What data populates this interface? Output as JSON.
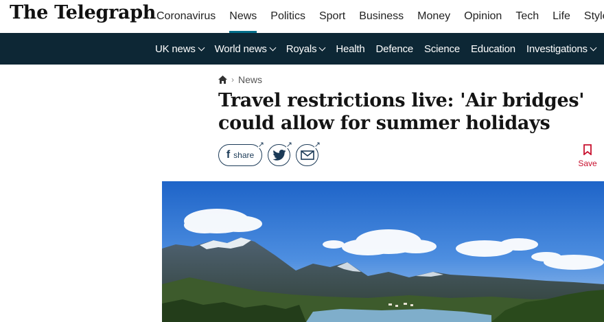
{
  "logo": "The Telegraph",
  "primary_nav": [
    "Coronavirus",
    "News",
    "Politics",
    "Sport",
    "Business",
    "Money",
    "Opinion",
    "Tech",
    "Life",
    "Style"
  ],
  "secondary_nav": [
    {
      "label": "UK news",
      "dropdown": true
    },
    {
      "label": "World news",
      "dropdown": true
    },
    {
      "label": "Royals",
      "dropdown": true
    },
    {
      "label": "Health",
      "dropdown": false
    },
    {
      "label": "Defence",
      "dropdown": false
    },
    {
      "label": "Science",
      "dropdown": false
    },
    {
      "label": "Education",
      "dropdown": false
    },
    {
      "label": "Investigations",
      "dropdown": true
    }
  ],
  "breadcrumb": {
    "section": "News"
  },
  "article": {
    "headline_line1": "Travel restrictions live: 'Air bridges'",
    "headline_line2": "could allow for summer holidays"
  },
  "share": {
    "facebook_label": "share"
  },
  "save_label": "Save",
  "colors": {
    "nav_bg": "#0d2735",
    "accent": "#036e8a",
    "save_red": "#c8102e"
  }
}
